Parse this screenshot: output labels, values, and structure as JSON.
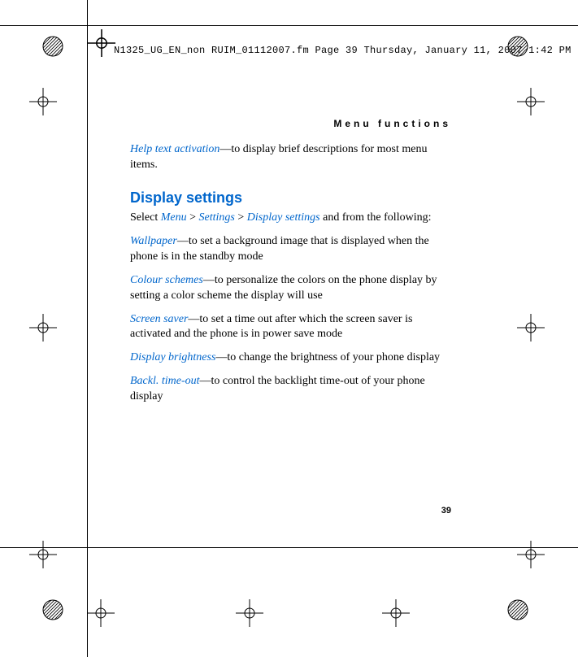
{
  "meta_line": "N1325_UG_EN_non RUIM_01112007.fm  Page 39  Thursday, January 11, 2007  1:42 PM",
  "running_head": "Menu functions",
  "page_number": "39",
  "content": {
    "help_text": {
      "term": "Help text activation",
      "desc": "—to display brief descriptions for most menu items."
    },
    "heading": "Display settings",
    "intro": {
      "lead": "Select ",
      "m1": "Menu",
      "gt1": " > ",
      "m2": "Settings",
      "gt2": " > ",
      "m3": "Display settings",
      "tail": " and from the following:"
    },
    "items": [
      {
        "term": "Wallpaper",
        "desc": "—to set a background image that is displayed when the phone is in the standby mode"
      },
      {
        "term": "Colour schemes",
        "desc": "—to personalize the colors on the phone display by setting a color scheme the display will use"
      },
      {
        "term": "Screen saver",
        "desc": "—to set a time out after which the screen saver is activated and the phone is in power save mode"
      },
      {
        "term": "Display brightness",
        "desc": "—to change the brightness of your phone display"
      },
      {
        "term": "Backl. time-out",
        "desc": "—to control the backlight time-out of your phone display"
      }
    ]
  }
}
